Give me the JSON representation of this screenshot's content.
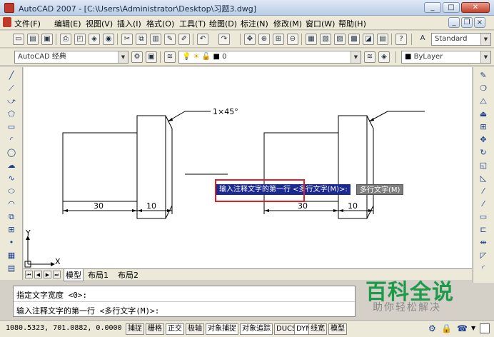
{
  "window": {
    "title": "AutoCAD 2007 - [C:\\Users\\Administrator\\Desktop\\习题3.dwg]",
    "min_label": "_",
    "max_label": "□",
    "close_label": "✕"
  },
  "menu": {
    "items": [
      "文件(F)",
      "编辑(E)",
      "视图(V)",
      "插入(I)",
      "格式(O)",
      "工具(T)",
      "绘图(D)",
      "标注(N)",
      "修改(M)",
      "窗口(W)",
      "帮助(H)"
    ]
  },
  "toolbar": {
    "text_style": "Standard",
    "workspace": "AutoCAD 经典",
    "layer": "0",
    "linetype": "ByLayer"
  },
  "drawing": {
    "chamfer_label": "1×45°",
    "dim_left_30": "30",
    "dim_left_10": "10",
    "dim_right_30": "30",
    "dim_right_10": "10",
    "ucs_y": "Y",
    "ucs_x": "X"
  },
  "tooltip": {
    "prompt": "输入注释文字的第一行 <多行文字(M)>:",
    "input_value": "多行文字(M)"
  },
  "tabs": {
    "items": [
      "模型",
      "布局1",
      "布局2"
    ]
  },
  "command": {
    "lines": [
      "指定文字宽度 <0>:",
      "输入注释文字的第一行 <多行文字(M)>:"
    ]
  },
  "status": {
    "coords": "1080.5323,  701.0882,  0.0000",
    "buttons": [
      "捕捉",
      "栅格",
      "正交",
      "极轴",
      "对象捕捉",
      "对象追踪",
      "DUCS",
      "DYN",
      "线宽",
      "模型"
    ]
  },
  "watermark": {
    "logo": "百科全说",
    "subtitle": "助你轻松解决"
  },
  "colors": {
    "tooltip_bg": "#1b2a8f",
    "highlight": "#e0202a",
    "watermark_green": "#1d9a4a"
  }
}
